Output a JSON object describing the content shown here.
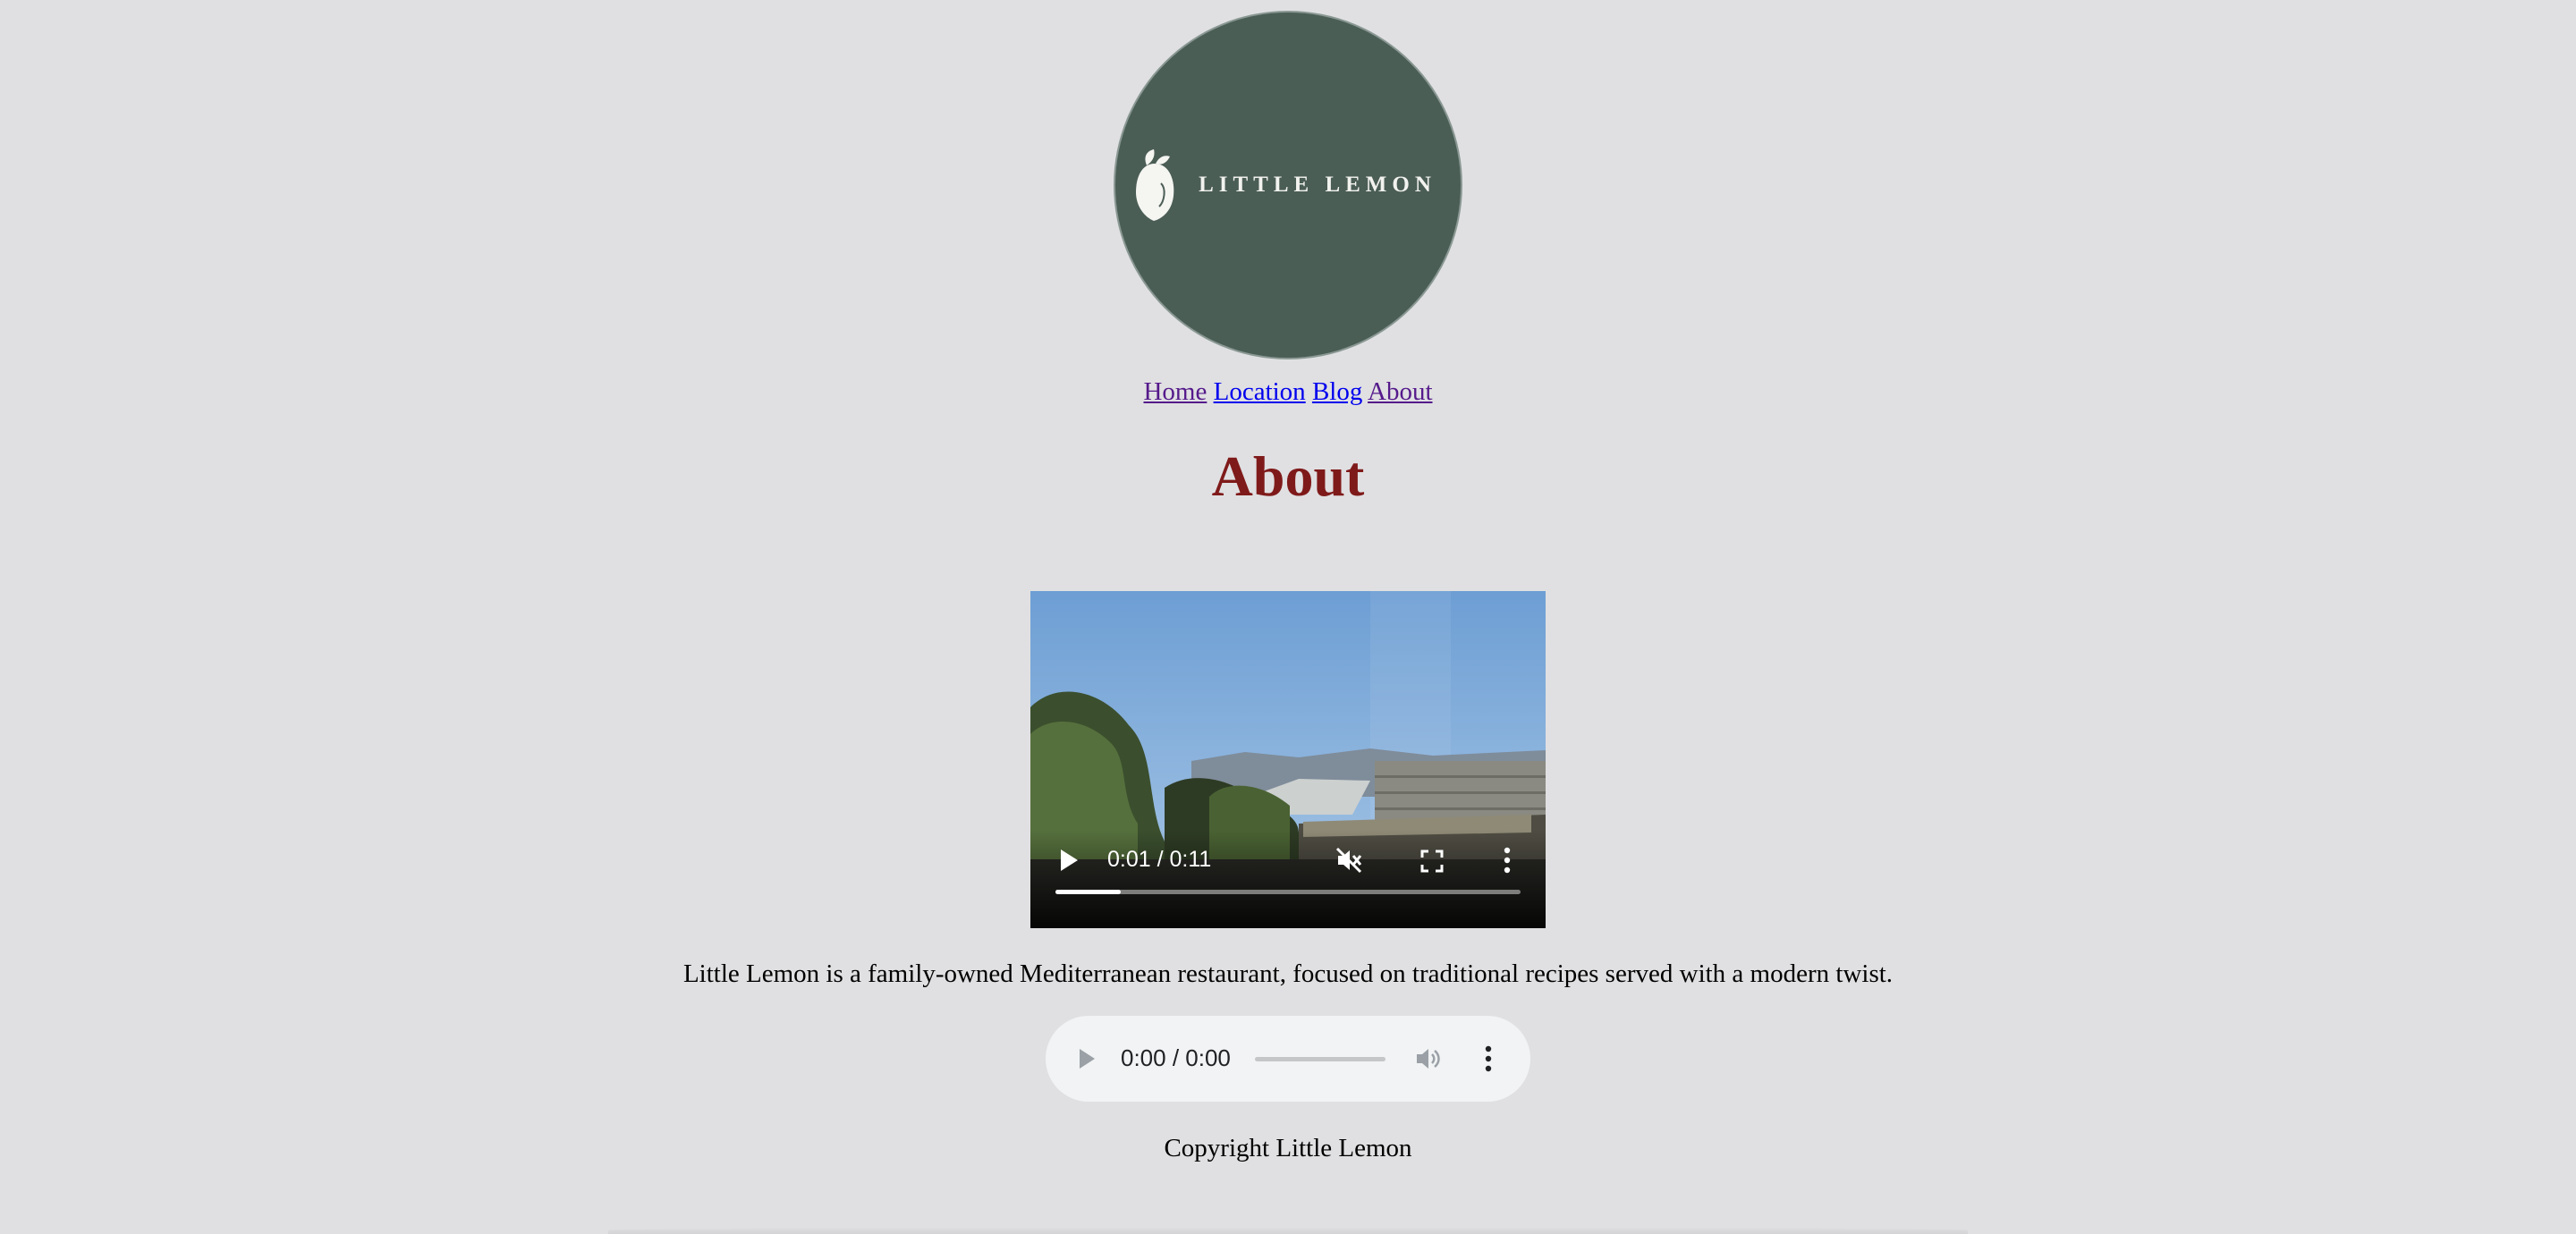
{
  "logo": {
    "text": "LITTLE LEMON",
    "icon": "lemon-icon",
    "bg_color": "#4b5e56"
  },
  "nav": {
    "links": [
      "Home",
      "Location",
      "Blog",
      "About"
    ]
  },
  "page": {
    "title": "About",
    "title_color": "#7f1a1a"
  },
  "video": {
    "time": "0:01 / 0:11",
    "progress": 0.14,
    "muted": true
  },
  "description": "Little Lemon is a family-owned Mediterranean restaurant, focused on traditional recipes served with a modern twist.",
  "audio": {
    "time": "0:00 / 0:00",
    "progress": 0
  },
  "footer": {
    "text": "Copyright Little Lemon"
  },
  "colors": {
    "background": "#e0e0e2",
    "link": "#0000ee",
    "visited_link": "#551a8b"
  }
}
